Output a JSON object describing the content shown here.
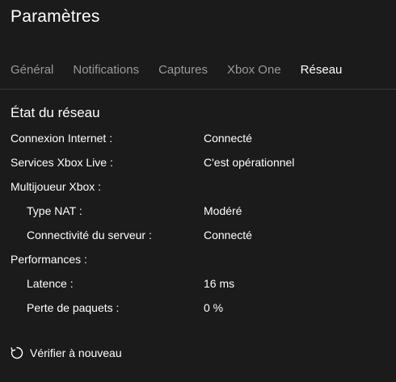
{
  "header": {
    "title": "Paramètres"
  },
  "tabs": [
    {
      "label": "Général",
      "active": false
    },
    {
      "label": "Notifications",
      "active": false
    },
    {
      "label": "Captures",
      "active": false
    },
    {
      "label": "Xbox One",
      "active": false
    },
    {
      "label": "Réseau",
      "active": true
    }
  ],
  "network": {
    "section_title": "État du réseau",
    "rows": [
      {
        "label": "Connexion Internet :",
        "value": "Connecté"
      },
      {
        "label": "Services Xbox Live :",
        "value": "C'est opérationnel"
      },
      {
        "label": "Multijoueur Xbox :",
        "value": ""
      },
      {
        "label": "Type NAT :",
        "value": "Modéré"
      },
      {
        "label": "Connectivité du serveur :",
        "value": "Connecté"
      },
      {
        "label": "Performances :",
        "value": ""
      },
      {
        "label": "Latence :",
        "value": "16 ms"
      },
      {
        "label": "Perte de paquets :",
        "value": "0 %"
      }
    ]
  },
  "actions": {
    "recheck_label": "Vérifier à nouveau",
    "recheck_icon": "refresh-icon"
  },
  "colors": {
    "background": "#1b1b1b",
    "text_primary": "#ffffff",
    "text_secondary": "#9a9a9a",
    "divider": "#3a3a3a"
  }
}
